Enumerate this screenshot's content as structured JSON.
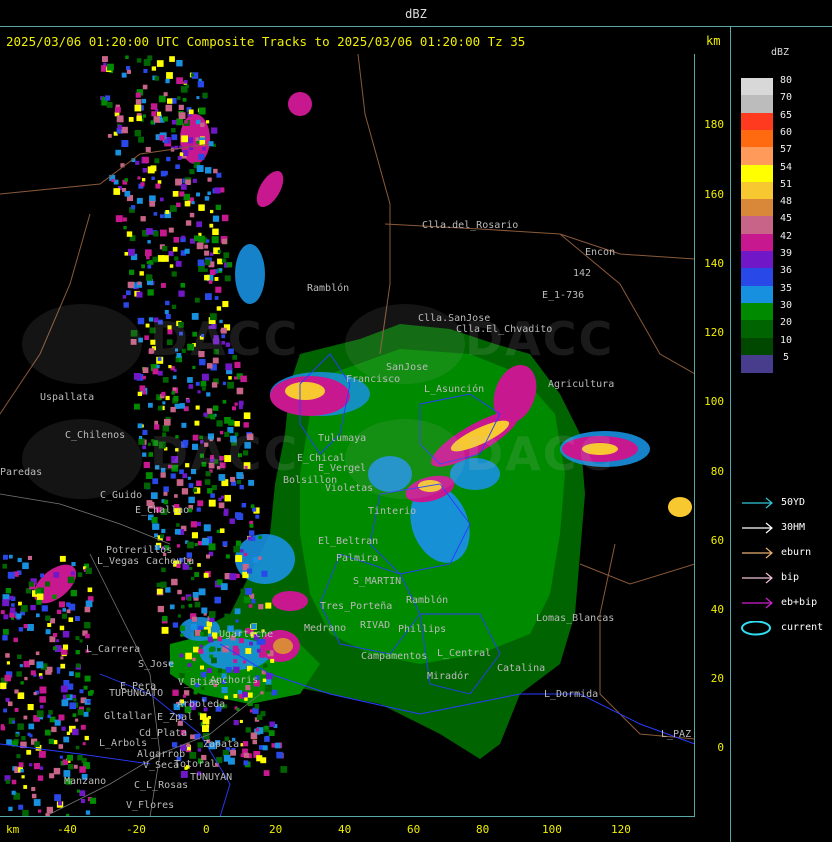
{
  "title": "dBZ",
  "header": "2025/03/06 01:20:00 UTC Composite Tracks to 2025/03/06 01:20:00 Tz 35",
  "km_unit": "km",
  "watermark": "DACC",
  "y_ticks": [
    "180",
    "160",
    "140",
    "120",
    "100",
    "80",
    "60",
    "40",
    "20",
    "0"
  ],
  "x_ticks": [
    "-40",
    "-20",
    "0",
    "20",
    "40",
    "60",
    "80",
    "100",
    "120"
  ],
  "legend": {
    "title": "dBZ",
    "levels": [
      {
        "label": "80",
        "color": "#d8d8d8"
      },
      {
        "label": "70",
        "color": "#bcbcbc"
      },
      {
        "label": "65",
        "color": "#ff3a1e"
      },
      {
        "label": "60",
        "color": "#ff6a10"
      },
      {
        "label": "57",
        "color": "#ff9a5a"
      },
      {
        "label": "54",
        "color": "#ffff00"
      },
      {
        "label": "51",
        "color": "#f8c830"
      },
      {
        "label": "48",
        "color": "#d88838"
      },
      {
        "label": "45",
        "color": "#c86488"
      },
      {
        "label": "42",
        "color": "#c81890"
      },
      {
        "label": "39",
        "color": "#7018c8"
      },
      {
        "label": "36",
        "color": "#2848e8"
      },
      {
        "label": "35",
        "color": "#1890e0"
      },
      {
        "label": "30",
        "color": "#008a00"
      },
      {
        "label": "20",
        "color": "#006400"
      },
      {
        "label": "10",
        "color": "#004800"
      },
      {
        "label": "5",
        "color": "#483c8c"
      }
    ]
  },
  "tracks": [
    {
      "label": "50YD",
      "color": "#30c8d8",
      "icon": "arrow-icon"
    },
    {
      "label": "30HM",
      "color": "#ffffff",
      "icon": "arrow-icon"
    },
    {
      "label": "eburn",
      "color": "#e8b070",
      "icon": "arrow-icon"
    },
    {
      "label": "bip",
      "color": "#f0c0d8",
      "icon": "arrow-icon"
    },
    {
      "label": "eb+bip",
      "color": "#d020d0",
      "icon": "arrow-icon"
    },
    {
      "label": "current",
      "color": "#30e0f0",
      "icon": "ellipse-icon"
    }
  ],
  "places": [
    {
      "name": "Clla.del_Rosario"
    },
    {
      "name": "Encon"
    },
    {
      "name": "142"
    },
    {
      "name": "E_1-736"
    },
    {
      "name": "Ramblón"
    },
    {
      "name": "Clla.SanJose"
    },
    {
      "name": "Clla.El_Chvadito"
    },
    {
      "name": "Uspallata"
    },
    {
      "name": "C_Chilenos"
    },
    {
      "name": "Paredas"
    },
    {
      "name": "C_Guido"
    },
    {
      "name": "E_Challao"
    },
    {
      "name": "Potrerillos"
    },
    {
      "name": "L_Vegas"
    },
    {
      "name": "Cacheuta"
    },
    {
      "name": "Tulumaya"
    },
    {
      "name": "E_Chical"
    },
    {
      "name": "E_Vergel"
    },
    {
      "name": "Bolsillon"
    },
    {
      "name": "Violetas"
    },
    {
      "name": "Tinterio"
    },
    {
      "name": "SanJose"
    },
    {
      "name": "L_Asunción"
    },
    {
      "name": "El_Beltran"
    },
    {
      "name": "Palmira"
    },
    {
      "name": "S_MARTIN"
    },
    {
      "name": "Tres_Porteña"
    },
    {
      "name": "Ramblón"
    },
    {
      "name": "RIVAD"
    },
    {
      "name": "Phillips"
    },
    {
      "name": "Lomas_Blancas"
    },
    {
      "name": "Ugarteche"
    },
    {
      "name": "Medrano"
    },
    {
      "name": "Campamentos"
    },
    {
      "name": "L_Central"
    },
    {
      "name": "Miradór"
    },
    {
      "name": "Catalina"
    },
    {
      "name": "L_Carrera"
    },
    {
      "name": "S_Jose"
    },
    {
      "name": "V_Btias"
    },
    {
      "name": "Anchoris"
    },
    {
      "name": "E_Pera"
    },
    {
      "name": "TUPUNGATO"
    },
    {
      "name": "Arboleda"
    },
    {
      "name": "Gltallar"
    },
    {
      "name": "E_Zpal"
    },
    {
      "name": "Cd_Plata"
    },
    {
      "name": "L_Arbols"
    },
    {
      "name": "Zapata"
    },
    {
      "name": "Algarrob"
    },
    {
      "name": "V_Seca"
    },
    {
      "name": "Totoral"
    },
    {
      "name": "Manzano"
    },
    {
      "name": "C_L_Rosas"
    },
    {
      "name": "TUNUYAN"
    },
    {
      "name": "V_Flores"
    },
    {
      "name": "L_Dormida"
    },
    {
      "name": "L_PAZ"
    },
    {
      "name": "Francisco"
    },
    {
      "name": "Agricultura"
    }
  ]
}
